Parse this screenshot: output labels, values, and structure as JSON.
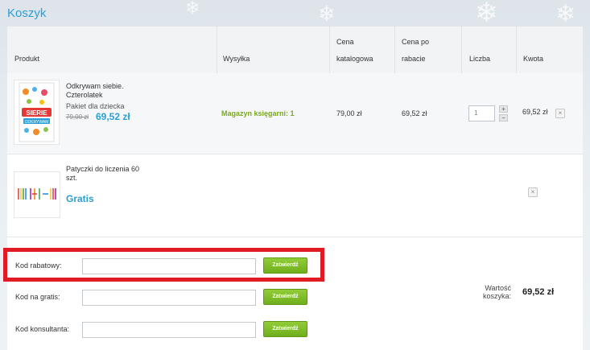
{
  "page": {
    "title": "Koszyk"
  },
  "table": {
    "headers": {
      "product": "Produkt",
      "shipping": "Wysyłka",
      "list_price_1": "Cena",
      "list_price_2": "katalogowa",
      "discount_price_1": "Cena po",
      "discount_price_2": "rabacie",
      "quantity": "Liczba",
      "amount": "Kwota"
    },
    "items": [
      {
        "name_line1": "Odkrywam siebie.",
        "name_line2": "Czterolatek",
        "subtitle": "Pakiet dla dziecka",
        "old_price": "79,00 zł",
        "price": "69,52 zł",
        "stock": "Magazyn księgarni: 1",
        "list_price": "79,00 zł",
        "discount_price": "69,52 zł",
        "quantity": "1",
        "amount": "69,52 zł",
        "thumb_text_1": "SIERIE",
        "thumb_text_2": "ODKRYWAM"
      },
      {
        "name_line1": "Patyczki do liczenia 60",
        "name_line2": "szt.",
        "price": "Gratis"
      }
    ]
  },
  "codes": [
    {
      "label": "Kod rabatowy:",
      "value": "",
      "button": "Zatwierdź"
    },
    {
      "label": "Kod na gratis:",
      "value": "",
      "button": "Zatwierdź"
    },
    {
      "label": "Kod konsultanta:",
      "value": "",
      "button": "Zatwierdź"
    }
  ],
  "summary": {
    "label_1": "Wartość",
    "label_2": "koszyka:",
    "value": "69,52 zł"
  },
  "colors": {
    "accent_blue": "#2a9fd6",
    "accent_green": "#7aa81e",
    "highlight_red": "#e01b24"
  },
  "icons": {
    "remove": "close-icon",
    "increment": "plus-icon",
    "decrement": "minus-icon"
  }
}
